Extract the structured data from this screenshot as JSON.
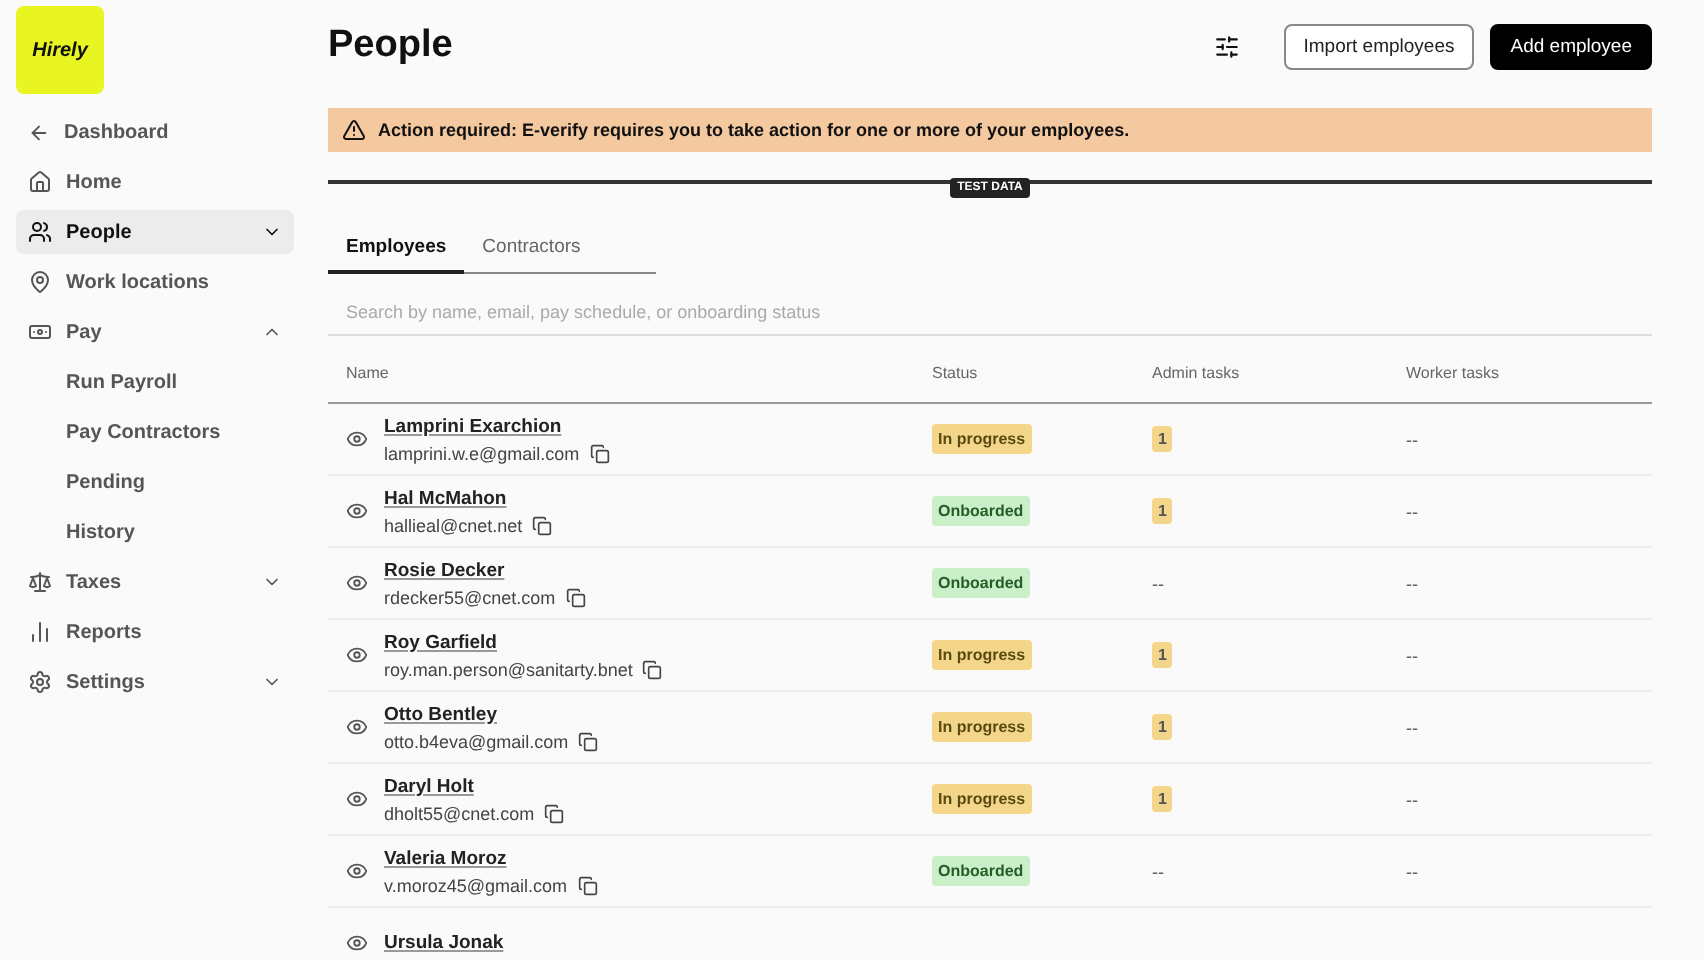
{
  "logo": {
    "text": "Hirely"
  },
  "sidebar": {
    "back": {
      "label": "Dashboard"
    },
    "items": [
      {
        "label": "Home",
        "selected": false
      },
      {
        "label": "People",
        "selected": true,
        "expanded": false
      },
      {
        "label": "Work locations",
        "selected": false
      },
      {
        "label": "Pay",
        "selected": false,
        "expanded": true,
        "children": [
          {
            "label": "Run Payroll"
          },
          {
            "label": "Pay Contractors"
          },
          {
            "label": "Pending"
          },
          {
            "label": "History"
          }
        ]
      },
      {
        "label": "Taxes",
        "selected": false,
        "expanded": false
      },
      {
        "label": "Reports",
        "selected": false
      },
      {
        "label": "Settings",
        "selected": false,
        "expanded": false
      }
    ]
  },
  "header": {
    "title": "People",
    "buttons": [
      {
        "label": "Import employees",
        "kind": "outline"
      },
      {
        "label": "Add employee",
        "kind": "primary"
      }
    ]
  },
  "alert": {
    "text": "Action required: E-verify requires you to take action for one or more of your employees."
  },
  "test_data_badge": "TEST DATA",
  "tabs": [
    {
      "label": "Employees",
      "selected": true
    },
    {
      "label": "Contractors",
      "selected": false
    }
  ],
  "search": {
    "placeholder": "Search by name, email, pay schedule, or onboarding status"
  },
  "table": {
    "columns": [
      "Name",
      "Status",
      "Admin tasks",
      "Worker tasks"
    ],
    "rows": [
      {
        "name": "Lamprini Exarchion",
        "email": "lamprini.w.e@gmail.com",
        "status": "In progress",
        "kind": "progress",
        "admin_tasks": "1",
        "worker_tasks": "--"
      },
      {
        "name": "Hal McMahon",
        "email": "hallieal@cnet.net",
        "status": "Onboarded",
        "kind": "done",
        "admin_tasks": "1",
        "worker_tasks": "--"
      },
      {
        "name": "Rosie Decker",
        "email": "rdecker55@cnet.com",
        "status": "Onboarded",
        "kind": "done",
        "admin_tasks": "--",
        "worker_tasks": "--"
      },
      {
        "name": "Roy Garfield",
        "email": "roy.man.person@sanitarty.bnet",
        "status": "In progress",
        "kind": "progress",
        "admin_tasks": "1",
        "worker_tasks": "--"
      },
      {
        "name": "Otto Bentley",
        "email": "otto.b4eva@gmail.com",
        "status": "In progress",
        "kind": "progress",
        "admin_tasks": "1",
        "worker_tasks": "--"
      },
      {
        "name": "Daryl Holt",
        "email": "dholt55@cnet.com",
        "status": "In progress",
        "kind": "progress",
        "admin_tasks": "1",
        "worker_tasks": "--"
      },
      {
        "name": "Valeria Moroz",
        "email": "v.moroz45@gmail.com",
        "status": "Onboarded",
        "kind": "done",
        "admin_tasks": "--",
        "worker_tasks": "--"
      },
      {
        "name": "Ursula Jonak"
      }
    ]
  }
}
